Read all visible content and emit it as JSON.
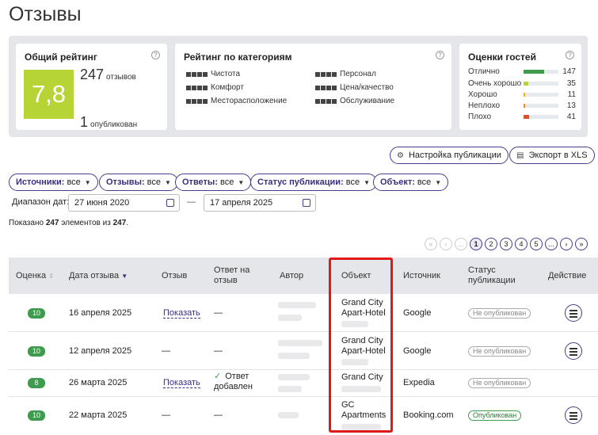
{
  "page_title": "Отзывы",
  "overall": {
    "title": "Общий рейтинг",
    "score": "7,8",
    "reviews_count": "247",
    "reviews_label": "отзывов",
    "published_count": "1",
    "published_label": "опубликован"
  },
  "categories": {
    "title": "Рейтинг по категориям",
    "items": [
      "Чистота",
      "Комфорт",
      "Месторасположение",
      "Персонал",
      "Цена/качество",
      "Обслуживание"
    ]
  },
  "guest_scores": {
    "title": "Оценки гостей",
    "rows": [
      {
        "label": "Отлично",
        "count": "147",
        "fraction": 0.6,
        "color": "#3f9c4f"
      },
      {
        "label": "Очень хорошо",
        "count": "35",
        "fraction": 0.14,
        "color": "#b7d436"
      },
      {
        "label": "Хорошо",
        "count": "11",
        "fraction": 0.05,
        "color": "#f2b600"
      },
      {
        "label": "Неплохо",
        "count": "13",
        "fraction": 0.05,
        "color": "#f08a1a"
      },
      {
        "label": "Плохо",
        "count": "41",
        "fraction": 0.17,
        "color": "#e2501f"
      }
    ]
  },
  "actions": {
    "publish_settings": "Настройка публикации",
    "export": "Экспорт в XLS"
  },
  "filters": [
    {
      "label": "Источники:",
      "value": "все"
    },
    {
      "label": "Отзывы:",
      "value": "все"
    },
    {
      "label": "Ответы:",
      "value": "все"
    },
    {
      "label": "Статус публикации:",
      "value": "все"
    },
    {
      "label": "Объект:",
      "value": "все"
    }
  ],
  "date_range": {
    "label": "Диапазон дат:",
    "from": "27 июня 2020",
    "to": "17 апреля 2025"
  },
  "shown": {
    "prefix": "Показано",
    "count": "247",
    "middle": "элементов из",
    "total": "247"
  },
  "pagination": {
    "first": "«",
    "prev": "‹",
    "ellipsis_left": "...",
    "pages": [
      "1",
      "2",
      "3",
      "4",
      "5"
    ],
    "ellipsis_right": "...",
    "next": "›",
    "last": "»"
  },
  "table": {
    "headers": [
      "Оценка",
      "Дата отзыва",
      "Отзыв",
      "Ответ на отзыв",
      "Автор",
      "Объект",
      "Источник",
      "Статус публикации",
      "Действие"
    ],
    "rows": [
      {
        "score": "10",
        "date": "16 апреля 2025",
        "review": "Показать",
        "reply": "—",
        "object_l1": "Grand City",
        "object_l2": "Apart-Hotel",
        "source": "Google",
        "status": "Не опубликован"
      },
      {
        "score": "10",
        "date": "12 апреля 2025",
        "review": "—",
        "reply": "—",
        "object_l1": "Grand City",
        "object_l2": "Apart-Hotel",
        "source": "Google",
        "status": "Не опубликован"
      },
      {
        "score": "8",
        "date": "26 марта 2025",
        "review": "Показать",
        "reply": "Ответ добавлен",
        "object_l1": "Grand City",
        "object_l2": "",
        "source": "Expedia",
        "status": "Не опубликован"
      },
      {
        "score": "10",
        "date": "22 марта 2025",
        "review": "—",
        "reply": "—",
        "object_l1": "GC",
        "object_l2": "Apartments",
        "source": "Booking.com",
        "status": "Опубликован"
      }
    ]
  }
}
